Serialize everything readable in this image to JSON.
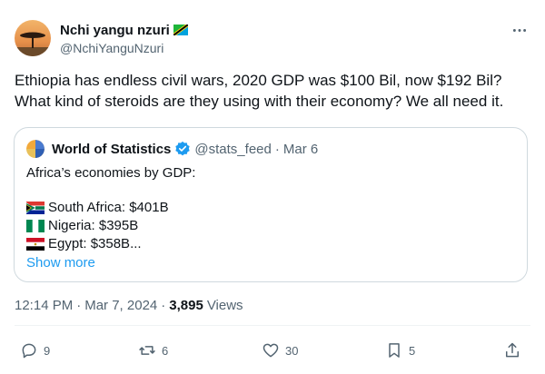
{
  "author": {
    "name": "Nchi yangu nzuri",
    "handle": "@NchiYanguNzuri",
    "flag_icon": "tanzania-flag-icon"
  },
  "tweet": {
    "line1": "Ethiopia has endless civil wars, 2020 GDP was $100 Bil, now $192 Bil?",
    "line2": "What kind of steroids are they using with their economy? We all need it."
  },
  "quote": {
    "name": "World of Statistics",
    "handle": "@stats_feed",
    "separator": "·",
    "date": "Mar 6",
    "intro": "Africa’s economies by GDP:",
    "items": [
      {
        "flag": "south-africa-flag-icon",
        "text": "South Africa: $401B"
      },
      {
        "flag": "nigeria-flag-icon",
        "text": "Nigeria: $395B"
      },
      {
        "flag": "egypt-flag-icon",
        "text": "Egypt: $358B..."
      }
    ],
    "show_more": "Show more"
  },
  "meta": {
    "time": "12:14 PM",
    "sep1": "·",
    "date": "Mar 7, 2024",
    "sep2": "·",
    "views_count": "3,895",
    "views_label": "Views"
  },
  "actions": {
    "replies": "9",
    "reposts": "6",
    "likes": "30",
    "bookmarks": "5"
  },
  "colors": {
    "text": "#0f1419",
    "secondary": "#536471",
    "accent": "#1d9bf0",
    "border": "#cfd9de"
  }
}
